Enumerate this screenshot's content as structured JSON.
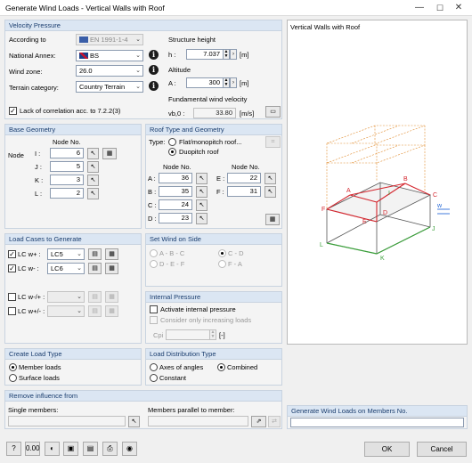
{
  "window": {
    "title": "Generate Wind Loads - Vertical Walls with Roof",
    "minimize": "—",
    "maximize": "☐",
    "close": "✕"
  },
  "velocity": {
    "header": "Velocity Pressure",
    "according_label": "According to",
    "according_value": "EN 1991-1-4",
    "annex_label": "National Annex:",
    "annex_value": "BS",
    "windzone_label": "Wind zone:",
    "windzone_value": "26.0",
    "terrain_label": "Terrain category:",
    "terrain_value": "Country Terrain",
    "lack_label": "Lack of correlation acc. to 7.2.2(3)",
    "lack_checked": true,
    "height_title": "Structure height",
    "h_label": "h :",
    "h_value": "7.037",
    "h_unit": "[m]",
    "alt_title": "Altitude",
    "a_label": "A :",
    "a_value": "300",
    "a_unit": "[m]",
    "fwv_title": "Fundamental wind velocity",
    "vb_label": "vb,0 :",
    "vb_value": "33.80",
    "vb_unit": "[m/s]"
  },
  "base": {
    "header": "Base Geometry",
    "col": "Node No.",
    "row_label": "Node",
    "rows": [
      {
        "k": "I :",
        "v": "6"
      },
      {
        "k": "J :",
        "v": "5"
      },
      {
        "k": "K :",
        "v": "3"
      },
      {
        "k": "L :",
        "v": "2"
      }
    ]
  },
  "roof": {
    "header": "Roof Type and Geometry",
    "type_label": "Type:",
    "opt1": "Flat/monopitch roof...",
    "opt2": "Duopitch roof",
    "col1": "Node No.",
    "col2": "Node No.",
    "left": [
      {
        "k": "A :",
        "v": "36"
      },
      {
        "k": "B :",
        "v": "35"
      },
      {
        "k": "C :",
        "v": "24"
      },
      {
        "k": "D :",
        "v": "23"
      }
    ],
    "right": [
      {
        "k": "E :",
        "v": "22"
      },
      {
        "k": "F :",
        "v": "31"
      }
    ]
  },
  "loadcases": {
    "header": "Load Cases to Generate",
    "rows": [
      {
        "label": "LC w+ :",
        "value": "LC5",
        "checked": true,
        "enabled": true
      },
      {
        "label": "LC w- :",
        "value": "LC6",
        "checked": true,
        "enabled": true
      },
      {
        "label": "LC w-/+ :",
        "value": "",
        "checked": false,
        "enabled": false
      },
      {
        "label": "LC w+/- :",
        "value": "",
        "checked": false,
        "enabled": false
      }
    ]
  },
  "side": {
    "header": "Set Wind on Side",
    "o1": "A - B - C",
    "o2": "C - D",
    "o3": "D - E - F",
    "o4": "F - A"
  },
  "internal": {
    "header": "Internal Pressure",
    "activate": "Activate internal pressure",
    "increasing": "Consider only increasing loads",
    "cpi_label": "Cpi :",
    "cpi_unit": "[-]"
  },
  "loadtype": {
    "header": "Create Load Type",
    "o1": "Member loads",
    "o2": "Surface loads"
  },
  "distribution": {
    "header": "Load Distribution Type",
    "o1": "Axes of angles",
    "o2": "Combined",
    "o3": "Constant"
  },
  "remove": {
    "header": "Remove influence from",
    "single": "Single members:",
    "parallel": "Members parallel to member:"
  },
  "preview": {
    "title": "Vertical Walls with Roof",
    "letters": {
      "A": "A",
      "B": "B",
      "C": "C",
      "D": "D",
      "E": "E",
      "F": "F",
      "I": "I",
      "J": "J",
      "K": "K",
      "L": "L",
      "w": "w"
    }
  },
  "generate": {
    "header": "Generate Wind Loads on Members No."
  },
  "footer": {
    "ok": "OK",
    "cancel": "Cancel"
  },
  "icons": {
    "picker": "cursor-pick-icon",
    "table": "table-icon",
    "info": "info-icon"
  }
}
